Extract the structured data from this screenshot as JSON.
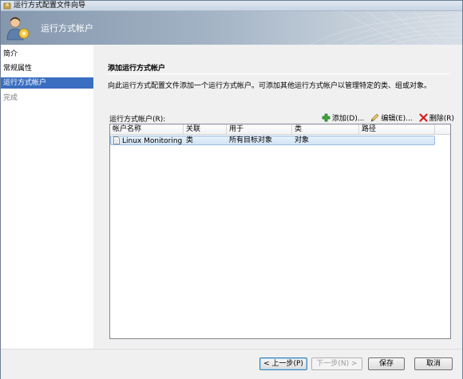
{
  "window": {
    "title": "运行方式配置文件向导"
  },
  "banner": {
    "title": "运行方式帐户"
  },
  "sidebar": {
    "items": [
      {
        "label": "简介"
      },
      {
        "label": "常规属性"
      },
      {
        "label": "运行方式帐户"
      },
      {
        "label": "完成"
      }
    ]
  },
  "main": {
    "section_title": "添加运行方式帐户",
    "description": "向此运行方式配置文件添加一个运行方式帐户。可添加其他运行方式帐户以管理特定的类、组或对象。",
    "list_label": "运行方式帐户(R):",
    "toolbar": {
      "add": "添加(D)...",
      "edit": "编辑(E)...",
      "delete": "删除(R)"
    },
    "columns": [
      "帐户名称",
      "关联",
      "用于",
      "类",
      "路径"
    ],
    "rows": [
      {
        "name": "Linux Monitoring",
        "association": "类",
        "used_for": "所有目标对象",
        "class": "对象",
        "path": ""
      }
    ]
  },
  "footer": {
    "prev": "< 上一步(P)",
    "next": "下一步(N) >",
    "save": "保存",
    "cancel": "取消"
  },
  "colors": {
    "selection": "#3a6ec0",
    "banner": "#8497ad"
  }
}
